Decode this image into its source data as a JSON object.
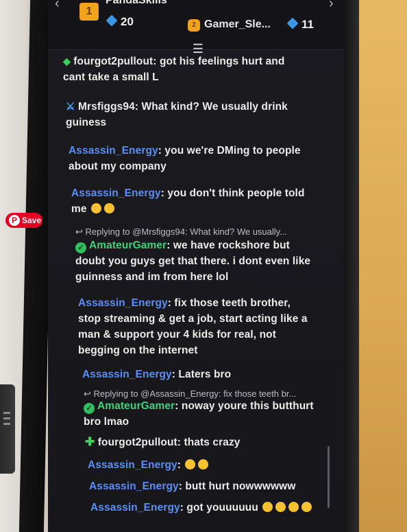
{
  "leaderboard": {
    "first": {
      "rank": "1",
      "name": "PandaSkills",
      "count": "20"
    },
    "second": {
      "name": "Gamer_Sle...",
      "count": "11"
    }
  },
  "messages": [
    {
      "user": "fourgot2pullout",
      "text": ": got his feelings hurt and",
      "text2": "cant take a small L"
    },
    {
      "user": "Mrsfiggs94",
      "text": ": What kind? We usually drink",
      "text2": "guiness"
    },
    {
      "user": "Assassin_Energy",
      "text": ": you we're DMing to people",
      "text2": "about my company"
    },
    {
      "user": "Assassin_Energy",
      "text": ": you don't think people told",
      "text2": "me"
    },
    {
      "reply": "Replying to @Mrsfiggs94: What kind? We usually...",
      "user": "AmateurGamer",
      "text": ": we have rockshore but",
      "text2": "doubt you guys get that there. i dont even like",
      "text3": "guinness and im from here lol"
    },
    {
      "user": "Assassin_Energy",
      "text": ": fix those teeth brother,",
      "text2": "stop streaming & get a job, start acting like a",
      "text3": "man & support your 4 kids for real, not",
      "text4": "begging on the internet"
    },
    {
      "user": "Assassin_Energy",
      "text": ": Laters bro"
    },
    {
      "reply": "Replying to @Assassin_Energy: fix those teeth br...",
      "user": "AmateurGamer",
      "text": ": noway youre this butthurt",
      "text2": "bro lmao"
    },
    {
      "user": "fourgot2pullout",
      "text": ": thats crazy"
    },
    {
      "user": "Assassin_Energy",
      "text": ":"
    },
    {
      "user": "Assassin_Energy",
      "text": ": butt hurt nowwwwww"
    },
    {
      "user": "Assassin_Energy",
      "text": ": got youuuuuu"
    }
  ],
  "pinterest": {
    "label": "Save"
  },
  "colors": {
    "username_blue": "#5b8ff5",
    "username_green": "#3fd07c",
    "panel_bg": "#1b1b20"
  }
}
